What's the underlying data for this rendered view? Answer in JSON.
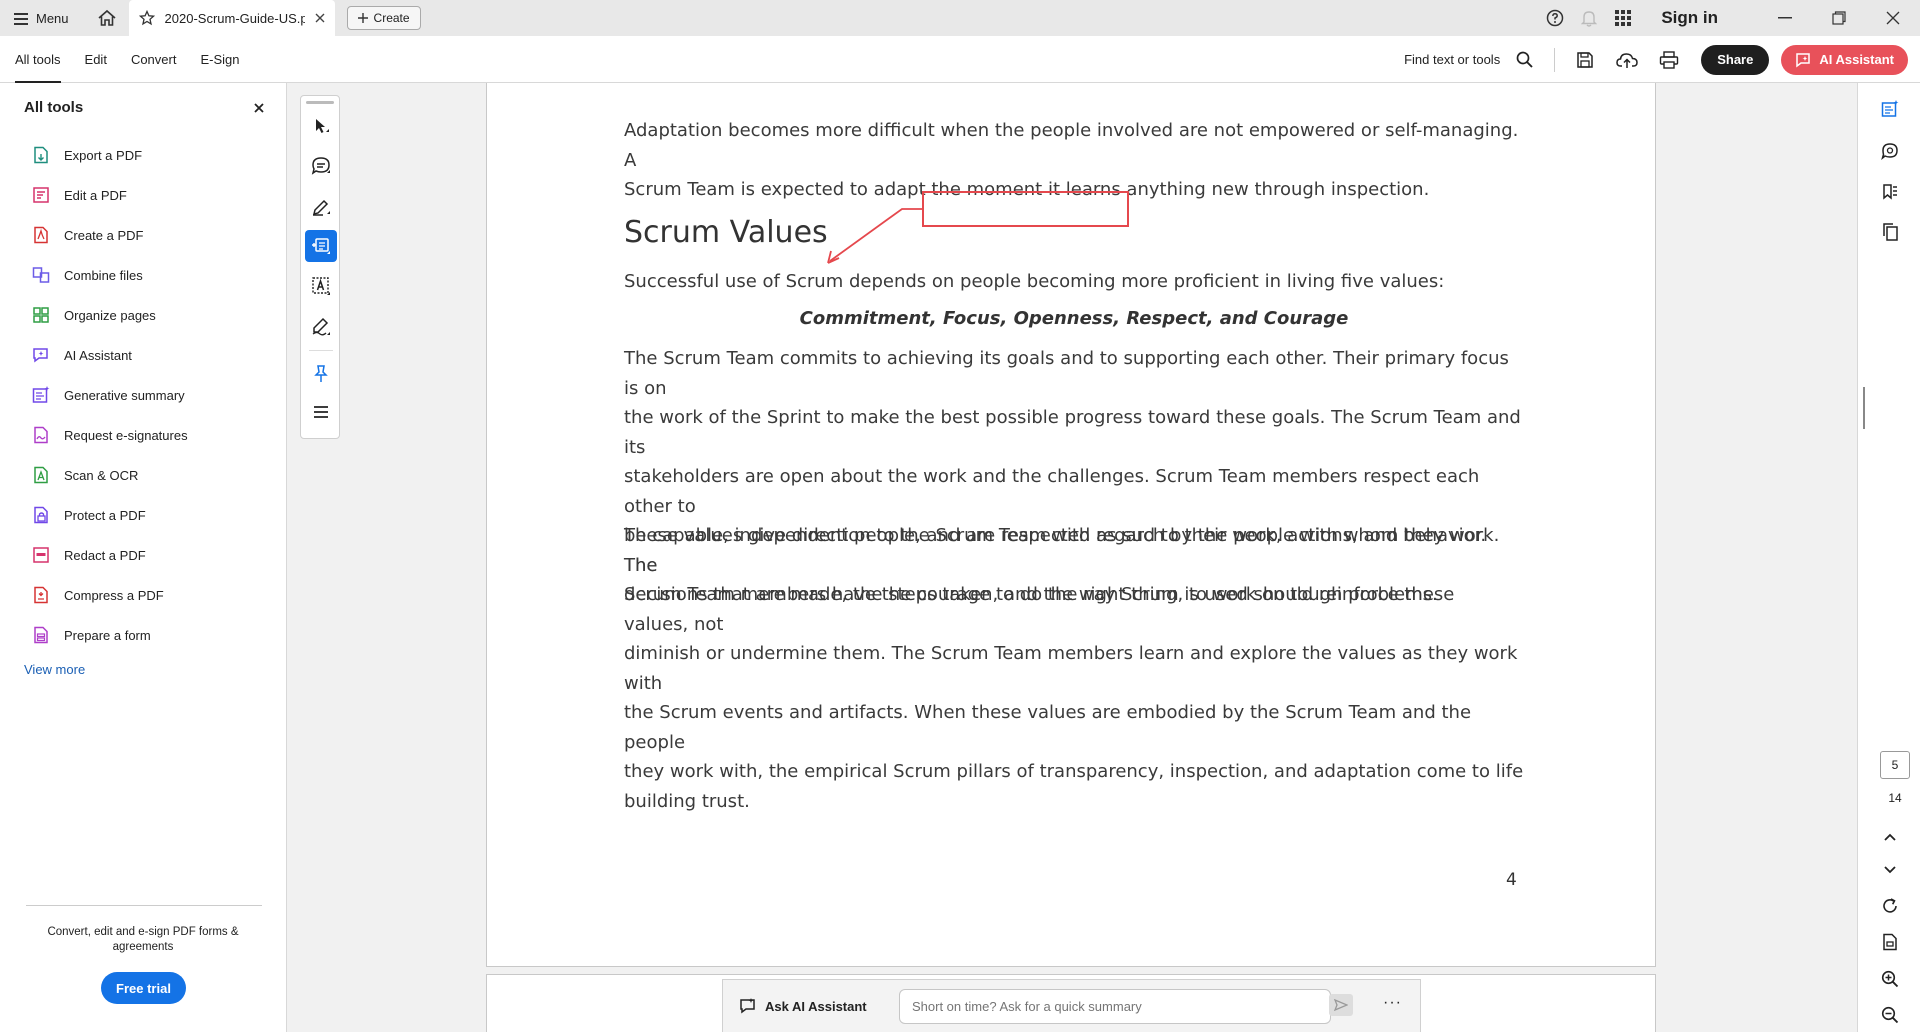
{
  "titlebar": {
    "menu_label": "Menu",
    "tab_title": "2020-Scrum-Guide-US.p...",
    "create_label": "Create",
    "sign_in": "Sign in"
  },
  "toolbar": {
    "tabs": [
      "All tools",
      "Edit",
      "Convert",
      "E-Sign"
    ],
    "find_label": "Find text or tools",
    "share_label": "Share",
    "ai_label": "AI Assistant"
  },
  "left_panel": {
    "title": "All tools",
    "items": [
      {
        "label": "Export a PDF",
        "icon": "export-pdf-icon",
        "color": "#1e8e7e"
      },
      {
        "label": "Edit a PDF",
        "icon": "edit-pdf-icon",
        "color": "#d6336c"
      },
      {
        "label": "Create a PDF",
        "icon": "create-pdf-icon",
        "color": "#d63333"
      },
      {
        "label": "Combine files",
        "icon": "combine-files-icon",
        "color": "#6c5ce7"
      },
      {
        "label": "Organize pages",
        "icon": "organize-pages-icon",
        "color": "#2f9e44"
      },
      {
        "label": "AI Assistant",
        "icon": "ai-assistant-icon",
        "color": "#7048e8"
      },
      {
        "label": "Generative summary",
        "icon": "generative-summary-icon",
        "color": "#7048e8"
      },
      {
        "label": "Request e-signatures",
        "icon": "request-esignatures-icon",
        "color": "#ae3ec9"
      },
      {
        "label": "Scan & OCR",
        "icon": "scan-ocr-icon",
        "color": "#2f9e44"
      },
      {
        "label": "Protect a PDF",
        "icon": "protect-pdf-icon",
        "color": "#7048e8"
      },
      {
        "label": "Redact a PDF",
        "icon": "redact-pdf-icon",
        "color": "#d6336c"
      },
      {
        "label": "Compress a PDF",
        "icon": "compress-pdf-icon",
        "color": "#d63333"
      },
      {
        "label": "Prepare a form",
        "icon": "prepare-form-icon",
        "color": "#ae3ec9"
      }
    ],
    "view_more": "View more",
    "promo": "Convert, edit and e-sign PDF forms & agreements",
    "trial_label": "Free trial"
  },
  "document": {
    "para_top": [
      "Adaptation becomes more difficult when the people involved are not empowered or self-managing. A",
      "Scrum Team is expected to adapt the moment it learns anything new through inspection."
    ],
    "heading": "Scrum Values",
    "intro": "Successful use of Scrum depends on people becoming more proficient in living five values:",
    "values_line": "Commitment, Focus, Openness, Respect, and Courage",
    "para2": [
      "The Scrum Team commits to achieving its goals and to supporting each other. Their primary focus is on",
      "the work of the Sprint to make the best possible progress toward these goals. The Scrum Team and its",
      "stakeholders are open about the work and the challenges. Scrum Team members respect each other to",
      "be capable, independent people, and are respected as such by the people with whom they work. The",
      "Scrum Team members have the courage to do the right thing, to work on tough problems."
    ],
    "para3": [
      "These values give direction to the Scrum Team with regard to their work, actions, and behavior. The",
      "decisions that are made, the steps taken, and the way Scrum is used should reinforce these values, not",
      "diminish or undermine them. The Scrum Team members learn and explore the values as they work with",
      "the Scrum events and artifacts. When these values are embodied by the Scrum Team and the people",
      "they work with, the empirical Scrum pillars of transparency, inspection, and adaptation come to life",
      "building trust."
    ],
    "page_number": "4"
  },
  "ask_bar": {
    "label": "Ask AI Assistant",
    "placeholder": "Short on time? Ask for a quick summary",
    "more": "···"
  },
  "navigation": {
    "current_page": "5",
    "total_pages": "14"
  },
  "colors": {
    "accent": "#1473e6",
    "ai_button": "#e8515a",
    "annotation": "#e5484d"
  }
}
